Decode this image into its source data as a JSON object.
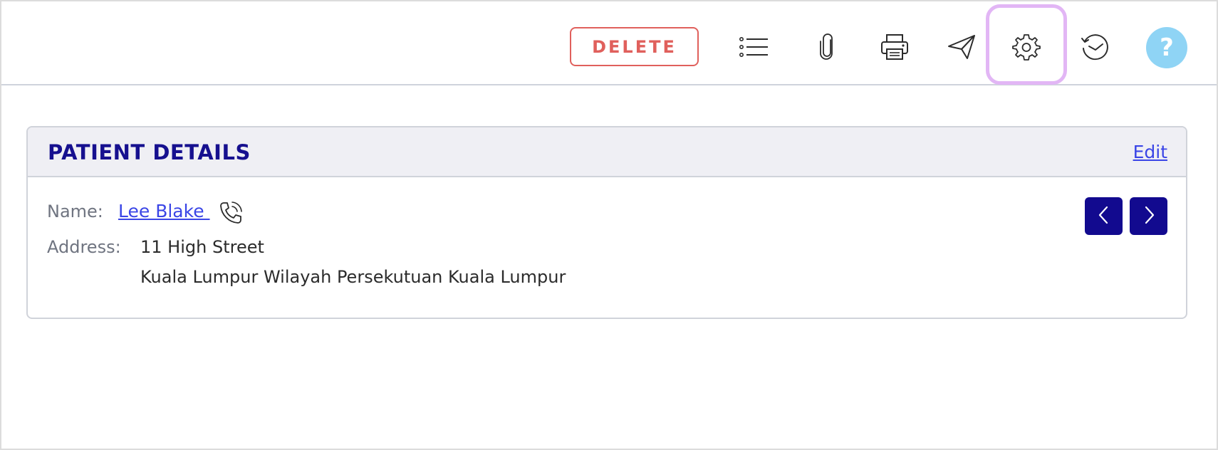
{
  "toolbar": {
    "delete_label": "DELETE",
    "help_label": "?",
    "icons": {
      "list": "list-icon",
      "attach": "paperclip-icon",
      "print": "printer-icon",
      "send": "paper-plane-icon",
      "settings": "gear-icon",
      "history": "clock-history-icon",
      "help": "help-icon"
    },
    "colors": {
      "delete": "#e0605c",
      "highlight": "#e2b6f5",
      "help_bg": "#8fd4f5"
    }
  },
  "patient_card": {
    "title": "PATIENT DETAILS",
    "edit_label": "Edit",
    "name_label": "Name:",
    "name_value": "Lee Blake ",
    "address_label": "Address:",
    "address_line1": "11 High Street",
    "address_line2": "Kuala Lumpur Wilayah Persekutuan Kuala Lumpur",
    "icons": {
      "phone": "phone-call-icon",
      "prev": "chevron-left-icon",
      "next": "chevron-right-icon"
    },
    "colors": {
      "title": "#16108f",
      "link": "#3a45e6",
      "nav_button": "#120a8f"
    }
  }
}
